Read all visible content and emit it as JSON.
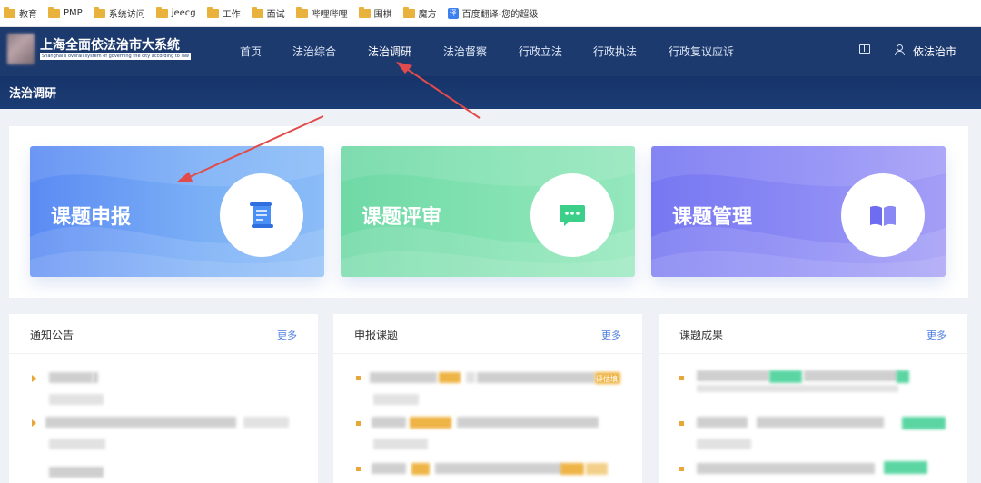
{
  "bookmarks": [
    {
      "label": "教育",
      "icon": "folder-icon"
    },
    {
      "label": "PMP",
      "icon": "folder-icon"
    },
    {
      "label": "系统访问",
      "icon": "folder-icon"
    },
    {
      "label": "jeecg",
      "icon": "folder-icon"
    },
    {
      "label": "工作",
      "icon": "folder-icon"
    },
    {
      "label": "面试",
      "icon": "folder-icon"
    },
    {
      "label": "哔哩哔哩",
      "icon": "folder-icon"
    },
    {
      "label": "围棋",
      "icon": "folder-icon"
    },
    {
      "label": "魔方",
      "icon": "folder-icon"
    },
    {
      "label": "百度翻译-您的超级",
      "icon": "translate-icon"
    }
  ],
  "header": {
    "site_title": "上海全面依法治市大系统",
    "site_subtitle": "Shanghai's overall system of governing the city according to law",
    "nav": [
      "首页",
      "法治综合",
      "法治调研",
      "法治督察",
      "行政立法",
      "行政执法",
      "行政复议应诉"
    ],
    "active_nav": "法治调研",
    "user_name": "依法治市"
  },
  "page_title": "法治调研",
  "cards": [
    {
      "label": "课题申报",
      "icon": "scroll-icon",
      "color": "#5b8bf3"
    },
    {
      "label": "课题评审",
      "icon": "chat-bubble-icon",
      "color": "#6fd9a6"
    },
    {
      "label": "课题管理",
      "icon": "book-icon",
      "color": "#7777f2"
    }
  ],
  "panels": [
    {
      "title": "通知公告",
      "more": "更多"
    },
    {
      "title": "申报课题",
      "more": "更多",
      "tag": "评估填"
    },
    {
      "title": "课题成果",
      "more": "更多"
    }
  ],
  "colors": {
    "nav_bg": "#1d3a6e",
    "accent_link": "#4a7de0",
    "annotation_arrow": "#e24b4b"
  }
}
